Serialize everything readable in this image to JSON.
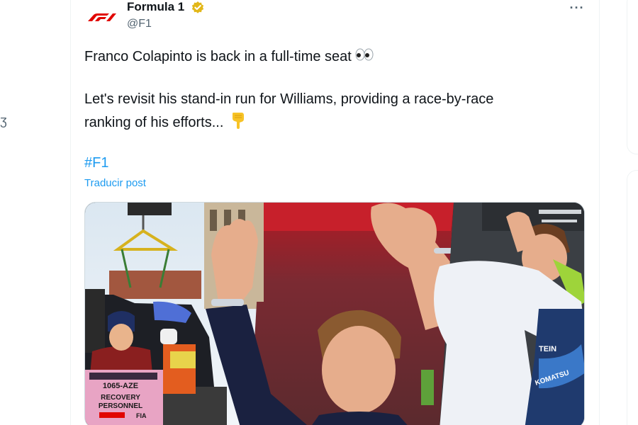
{
  "post": {
    "author_name": "Formula 1",
    "handle": "@F1",
    "more_label": "···",
    "text_line1": "Franco Colapinto is back in a full-time seat",
    "text_line2": "Let's revisit his stand-in run for Williams, providing a race-by-race",
    "text_line3": "ranking of his efforts...",
    "hashtag": "#F1",
    "translate_label": "Traducir post",
    "media": {
      "vest_plate": "1065-AZE",
      "vest_line1": "RECOVERY",
      "vest_line2": "PERSONNEL",
      "vest_fia": "FIA",
      "shirt_text1": "TEIN",
      "shirt_text2": "KOMATSU"
    }
  },
  "colors": {
    "accent": "#1d9bf0",
    "text": "#0f1419",
    "secondary": "#536471",
    "f1_red": "#e10600",
    "verified_gold": "#e2b719"
  },
  "icons": [
    "f1-logo",
    "verified-badge-icon",
    "more-options-icon",
    "eyes-emoji",
    "pointing-down-emoji"
  ]
}
